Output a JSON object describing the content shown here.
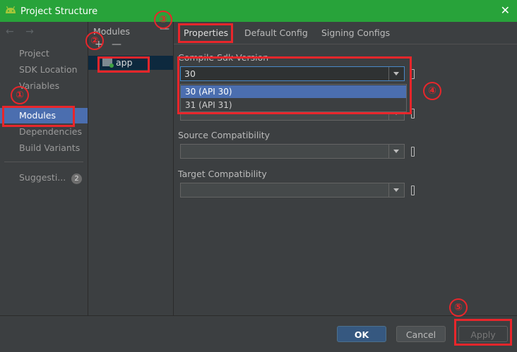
{
  "window": {
    "title": "Project Structure",
    "close_glyph": "✕"
  },
  "nav": {
    "back_forward": "← →",
    "items": [
      {
        "label": "Project"
      },
      {
        "label": "SDK Location"
      },
      {
        "label": "Variables"
      },
      {
        "label": "Modules"
      },
      {
        "label": "Dependencies"
      },
      {
        "label": "Build Variants"
      }
    ],
    "suggestions": {
      "label": "Suggesti...",
      "count": "2"
    },
    "selected": "Modules"
  },
  "modules_panel": {
    "header": "Modules",
    "collapse_glyph": "—",
    "add_glyph": "+",
    "remove_glyph": "—",
    "items": [
      {
        "label": "app"
      }
    ]
  },
  "tabs": [
    {
      "label": "Properties",
      "active": true
    },
    {
      "label": "Default Config"
    },
    {
      "label": "Signing Configs"
    }
  ],
  "form": {
    "compile_sdk": {
      "label": "Compile Sdk Version",
      "value": "30"
    },
    "build_tools_value": "",
    "source_compat": {
      "label": "Source Compatibility",
      "value": ""
    },
    "target_compat": {
      "label": "Target Compatibility",
      "value": ""
    }
  },
  "dropdown_options": [
    {
      "label": "30 (API 30)",
      "selected": true
    },
    {
      "label": "31 (API 31)"
    }
  ],
  "footer": {
    "ok": "OK",
    "cancel": "Cancel",
    "apply": "Apply"
  },
  "annotations": [
    "①",
    "②",
    "③",
    "④",
    "⑤"
  ],
  "colors": {
    "titlebar": "#28a33a",
    "selection": "#4b6eaf",
    "annotation": "#e8262b",
    "ok_button": "#365880"
  },
  "icons": [
    "android-logo-icon",
    "close-icon",
    "back-arrow-icon",
    "forward-arrow-icon",
    "module-folder-icon",
    "chevron-down-icon"
  ]
}
